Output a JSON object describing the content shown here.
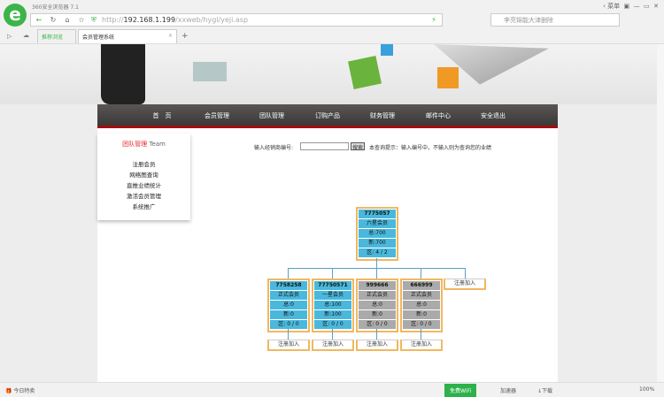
{
  "browser": {
    "title": "360安全浏览器 7.1",
    "url_host": "192.168.1.199",
    "url_prefix": "http://",
    "url_path": "/xxweb/hygl/yeji.asp",
    "search_placeholder": "李亮锦能大津删除",
    "tabs": [
      "推荐浏览",
      "会员管理系统"
    ],
    "menu": "菜单"
  },
  "nav": [
    "首　页",
    "会员管理",
    "团队管理",
    "订购产品",
    "财务管理",
    "邮件中心",
    "安全退出"
  ],
  "sidebar": {
    "title": "团队管理",
    "title_en": "Team",
    "items": [
      "注册会员",
      "网络图查询",
      "直推业绩统计",
      "激活会员管理",
      "系统推广"
    ]
  },
  "query": {
    "label": "输入经销商编号:",
    "value": "",
    "button": "搜索",
    "hint": "本查询提示：输入编号中，不输入则为查询您的业绩"
  },
  "tree": {
    "root": {
      "id": "7775057",
      "level": "六星会员",
      "total": "总:700",
      "new": "新:700",
      "area": "区: 4 / 2"
    },
    "children": [
      {
        "id": "7758258",
        "level": "正式会员",
        "total": "总:0",
        "new": "新:0",
        "area": "区: 0 / 0",
        "color": "blue"
      },
      {
        "id": "77750571",
        "level": "一星会员",
        "total": "总:100",
        "new": "新:100",
        "area": "区: 0 / 0",
        "color": "blue"
      },
      {
        "id": "999666",
        "level": "正式会员",
        "total": "总:0",
        "new": "新:0",
        "area": "区: 0 / 0",
        "color": "gray"
      },
      {
        "id": "666999",
        "level": "正式会员",
        "total": "总:0",
        "new": "新:0",
        "area": "区: 0 / 0",
        "color": "gray"
      }
    ],
    "register_label": "注册加入"
  },
  "status": {
    "left": "今日特卖",
    "right": [
      "免费WiFi",
      "加速器",
      "下载",
      "100%"
    ]
  }
}
